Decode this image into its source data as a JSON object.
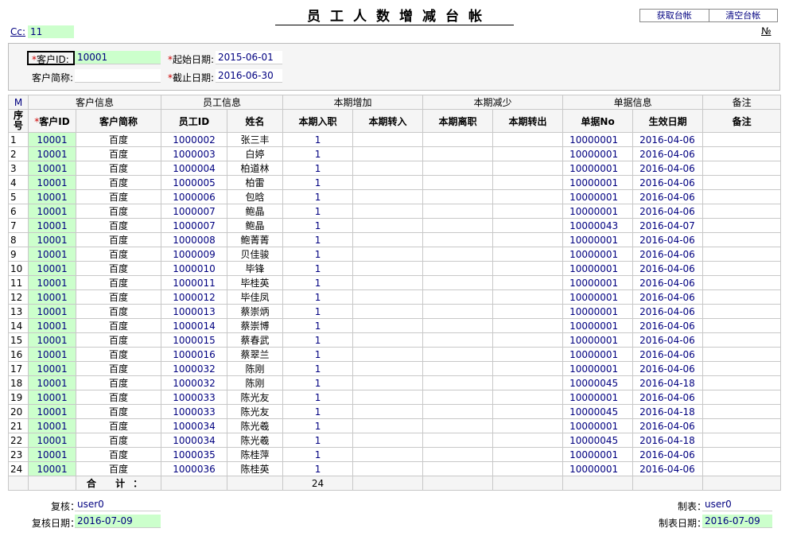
{
  "header": {
    "title": "员工人数增减台帐",
    "buttons": [
      "获取台帐",
      "清空台帐"
    ],
    "cc_label": "Cc",
    "cc_value": "11",
    "no_label": "№"
  },
  "filters": {
    "customer_id_label": "*客户ID",
    "customer_id_value": "10001",
    "customer_short_label": "客户简称",
    "customer_short_value": "",
    "start_date_label": "*起始日期",
    "start_date_value": "2015-06-01",
    "end_date_label": "*截止日期",
    "end_date_value": "2016-06-30"
  },
  "table": {
    "group_headers": [
      "M",
      "客户信息",
      "员工信息",
      "本期增加",
      "本期减少",
      "单据信息",
      "备注"
    ],
    "columns": [
      "序号",
      "*客户ID",
      "客户简称",
      "员工ID",
      "姓名",
      "本期入职",
      "本期转入",
      "本期离职",
      "本期转出",
      "单据No",
      "生效日期",
      "备注"
    ],
    "rows": [
      [
        "1",
        "10001",
        "百度",
        "1000002",
        "张三丰",
        "1",
        "",
        "",
        "",
        "10000001",
        "2016-04-06",
        ""
      ],
      [
        "2",
        "10001",
        "百度",
        "1000003",
        "白婷",
        "1",
        "",
        "",
        "",
        "10000001",
        "2016-04-06",
        ""
      ],
      [
        "3",
        "10001",
        "百度",
        "1000004",
        "柏道林",
        "1",
        "",
        "",
        "",
        "10000001",
        "2016-04-06",
        ""
      ],
      [
        "4",
        "10001",
        "百度",
        "1000005",
        "柏雷",
        "1",
        "",
        "",
        "",
        "10000001",
        "2016-04-06",
        ""
      ],
      [
        "5",
        "10001",
        "百度",
        "1000006",
        "包晗",
        "1",
        "",
        "",
        "",
        "10000001",
        "2016-04-06",
        ""
      ],
      [
        "6",
        "10001",
        "百度",
        "1000007",
        "鲍晶",
        "1",
        "",
        "",
        "",
        "10000001",
        "2016-04-06",
        ""
      ],
      [
        "7",
        "10001",
        "百度",
        "1000007",
        "鲍晶",
        "1",
        "",
        "",
        "",
        "10000043",
        "2016-04-07",
        ""
      ],
      [
        "8",
        "10001",
        "百度",
        "1000008",
        "鲍菁菁",
        "1",
        "",
        "",
        "",
        "10000001",
        "2016-04-06",
        ""
      ],
      [
        "9",
        "10001",
        "百度",
        "1000009",
        "贝佳骏",
        "1",
        "",
        "",
        "",
        "10000001",
        "2016-04-06",
        ""
      ],
      [
        "10",
        "10001",
        "百度",
        "1000010",
        "毕锋",
        "1",
        "",
        "",
        "",
        "10000001",
        "2016-04-06",
        ""
      ],
      [
        "11",
        "10001",
        "百度",
        "1000011",
        "毕桂英",
        "1",
        "",
        "",
        "",
        "10000001",
        "2016-04-06",
        ""
      ],
      [
        "12",
        "10001",
        "百度",
        "1000012",
        "毕佳凤",
        "1",
        "",
        "",
        "",
        "10000001",
        "2016-04-06",
        ""
      ],
      [
        "13",
        "10001",
        "百度",
        "1000013",
        "蔡崇炳",
        "1",
        "",
        "",
        "",
        "10000001",
        "2016-04-06",
        ""
      ],
      [
        "14",
        "10001",
        "百度",
        "1000014",
        "蔡崇博",
        "1",
        "",
        "",
        "",
        "10000001",
        "2016-04-06",
        ""
      ],
      [
        "15",
        "10001",
        "百度",
        "1000015",
        "蔡春武",
        "1",
        "",
        "",
        "",
        "10000001",
        "2016-04-06",
        ""
      ],
      [
        "16",
        "10001",
        "百度",
        "1000016",
        "蔡翠兰",
        "1",
        "",
        "",
        "",
        "10000001",
        "2016-04-06",
        ""
      ],
      [
        "17",
        "10001",
        "百度",
        "1000032",
        "陈刚",
        "1",
        "",
        "",
        "",
        "10000001",
        "2016-04-06",
        ""
      ],
      [
        "18",
        "10001",
        "百度",
        "1000032",
        "陈刚",
        "1",
        "",
        "",
        "",
        "10000045",
        "2016-04-18",
        ""
      ],
      [
        "19",
        "10001",
        "百度",
        "1000033",
        "陈光友",
        "1",
        "",
        "",
        "",
        "10000001",
        "2016-04-06",
        ""
      ],
      [
        "20",
        "10001",
        "百度",
        "1000033",
        "陈光友",
        "1",
        "",
        "",
        "",
        "10000045",
        "2016-04-18",
        ""
      ],
      [
        "21",
        "10001",
        "百度",
        "1000034",
        "陈光羲",
        "1",
        "",
        "",
        "",
        "10000001",
        "2016-04-06",
        ""
      ],
      [
        "22",
        "10001",
        "百度",
        "1000034",
        "陈光羲",
        "1",
        "",
        "",
        "",
        "10000045",
        "2016-04-18",
        ""
      ],
      [
        "23",
        "10001",
        "百度",
        "1000035",
        "陈桂萍",
        "1",
        "",
        "",
        "",
        "10000001",
        "2016-04-06",
        ""
      ],
      [
        "24",
        "10001",
        "百度",
        "1000036",
        "陈桂英",
        "1",
        "",
        "",
        "",
        "10000001",
        "2016-04-06",
        ""
      ]
    ],
    "sum_label": "合 计：",
    "sum_value": "24"
  },
  "footer": {
    "reviewer_label": "复核：",
    "reviewer_value": "user0",
    "review_date_label": "复核日期：",
    "review_date_value": "2016-07-09",
    "maker_label": "制表：",
    "maker_value": "user0",
    "make_date_label": "制表日期：",
    "make_date_value": "2016-07-09"
  }
}
